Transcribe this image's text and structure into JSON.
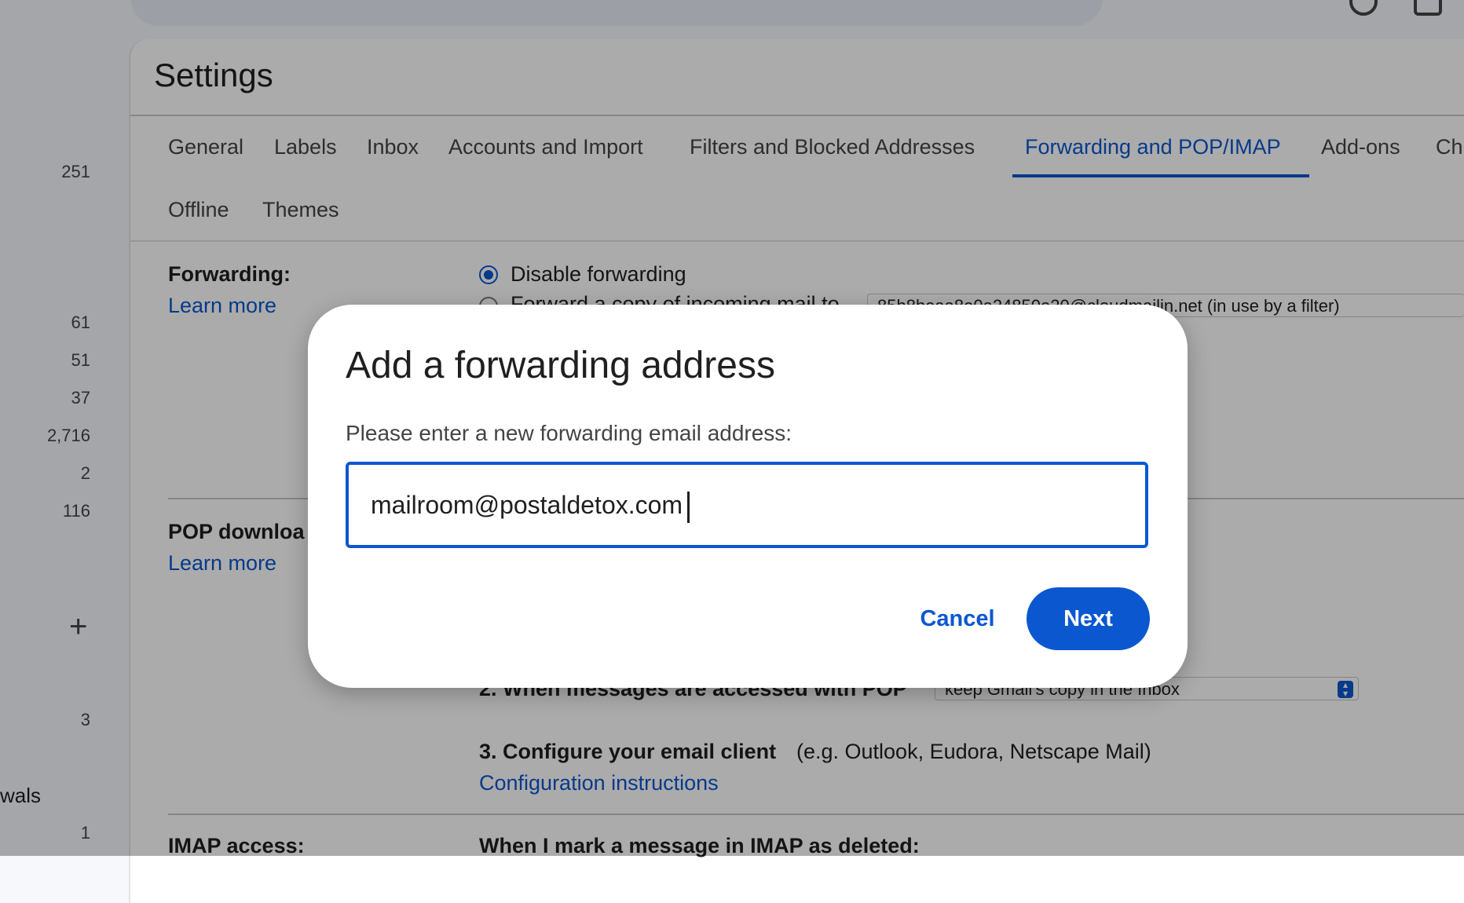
{
  "sidebar": {
    "counts": [
      "251",
      "61",
      "51",
      "37",
      "2,716",
      "2",
      "116",
      "3",
      "1"
    ],
    "partial_label": "wals",
    "add_icon": "plus-icon"
  },
  "settings": {
    "title": "Settings",
    "tabs": [
      {
        "label": "General"
      },
      {
        "label": "Labels"
      },
      {
        "label": "Inbox"
      },
      {
        "label": "Accounts and Import"
      },
      {
        "label": "Filters and Blocked Addresses"
      },
      {
        "label": "Forwarding and POP/IMAP",
        "active": true
      },
      {
        "label": "Add-ons"
      },
      {
        "label": "Ch"
      },
      {
        "label": "Offline"
      },
      {
        "label": "Themes"
      }
    ],
    "forwarding": {
      "label": "Forwarding:",
      "learn_more": "Learn more",
      "option_disable": "Disable forwarding",
      "option_forward": "Forward a copy of incoming mail to",
      "forward_address": "85b8beaa8e0a24850e20@cloudmailin.net (in use by a filter)"
    },
    "pop": {
      "label": "POP downloa",
      "learn_more": "Learn more",
      "step2_label": "2. When messages are accessed with POP",
      "step2_value": "keep Gmail's copy in the Inbox",
      "step3_label": "3. Configure your email client",
      "step3_hint": "(e.g. Outlook, Eudora, Netscape Mail)",
      "config_link": "Configuration instructions"
    },
    "imap": {
      "label": "IMAP access:",
      "deleted_label": "When I mark a message in IMAP as deleted:"
    }
  },
  "dialog": {
    "title": "Add a forwarding address",
    "prompt": "Please enter a new forwarding email address:",
    "input_value": "mailroom@postaldetox.com",
    "cancel_label": "Cancel",
    "next_label": "Next"
  },
  "colors": {
    "accent": "#0b57d0",
    "overlay": "rgba(0,0,0,0.33)"
  }
}
